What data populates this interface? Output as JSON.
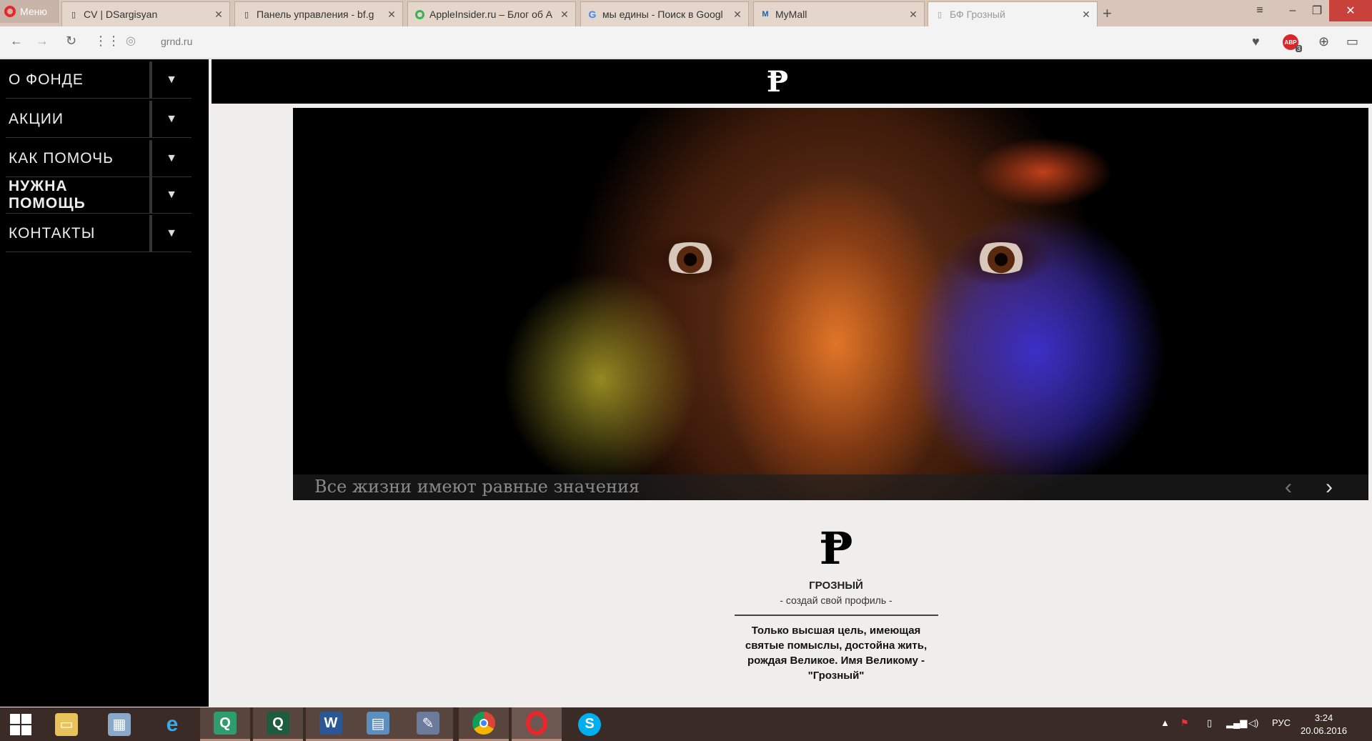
{
  "browser": {
    "menu_label": "Меню",
    "tabs": [
      {
        "title": "CV | DSargisyan",
        "close": "✕",
        "icon": "page-icon"
      },
      {
        "title": "Панель управления - bf.g",
        "close": "✕",
        "icon": "page-icon"
      },
      {
        "title": "AppleInsider.ru – Блог об A",
        "close": "✕",
        "icon": "green-circle-icon"
      },
      {
        "title": "мы едины - Поиск в Googl",
        "close": "✕",
        "icon": "google-icon"
      },
      {
        "title": "MyMall",
        "close": "✕",
        "icon": "mymall-icon"
      },
      {
        "title": "БФ Грозный",
        "close": "✕",
        "icon": "page-icon",
        "active": true
      }
    ],
    "new_tab": "+",
    "url": "grnd.ru",
    "abp_label": "ABP",
    "abp_count": "3"
  },
  "nav": {
    "items": [
      {
        "label": "О ФОНДЕ",
        "arrow": "▼"
      },
      {
        "label": "АКЦИИ",
        "arrow": "▼"
      },
      {
        "label": "КАК ПОМОЧЬ",
        "arrow": "▼"
      },
      {
        "label": "НУЖНА ПОМОЩЬ",
        "arrow": "▼"
      },
      {
        "label": "КОНТАКТЫ",
        "arrow": "▼"
      }
    ]
  },
  "header": {
    "logo": "Ᵽ"
  },
  "slider": {
    "caption": "Все жизни имеют равные значения",
    "prev": "‹",
    "next": "›"
  },
  "content": {
    "logo": "Ᵽ",
    "brand": "ГРОЗНЫЙ",
    "tagline": "- создай свой профиль -",
    "quote": "Только высшая цель, имеющая святые помыслы, достойна жить, рождая Великое. Имя Великому - \"Грозный\""
  },
  "taskbar": {
    "language": "РУС",
    "time": "3:24",
    "date": "20.06.2016"
  },
  "colors": {
    "tab_strip": "#d8c6bb",
    "sidebar": "#000000",
    "page_bg": "#efeeec",
    "taskbar": "#3a2b26"
  }
}
